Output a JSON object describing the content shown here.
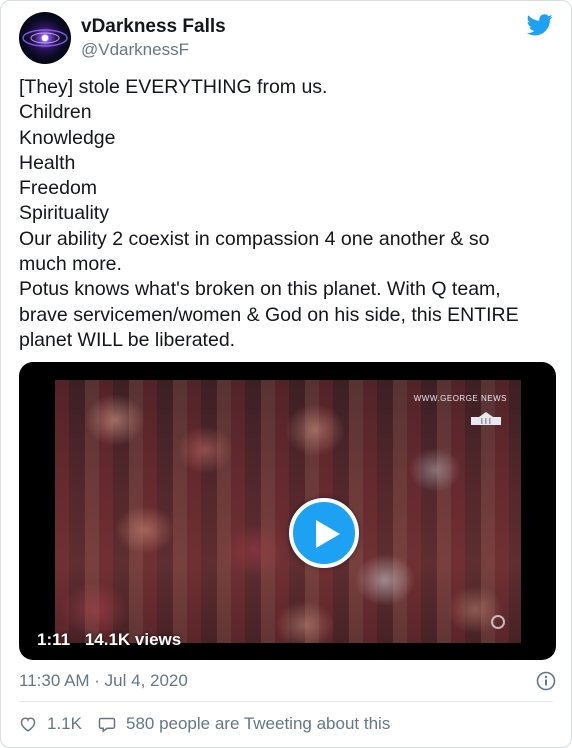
{
  "tweet": {
    "display_name": "vDarkness Falls",
    "handle": "@VdarknessF",
    "lines": [
      "[They] stole EVERYTHING from us.",
      "Children",
      "Knowledge",
      "Health",
      "Freedom",
      "Spirituality",
      "Our ability 2 coexist in compassion 4 one another & so",
      "much more.",
      "Potus knows what's broken on this planet. With Q team,",
      "brave servicemen/women & God on his side, this ENTIRE",
      "planet WILL be liberated."
    ],
    "timestamp": "11:30 AM · Jul 4, 2020"
  },
  "video": {
    "duration": "1:11",
    "views": "14.1K views",
    "watermark": "WWW.GEORGE NEWS"
  },
  "footer": {
    "likes": "1.1K",
    "conversation": "580 people are Tweeting about this"
  },
  "colors": {
    "accent": "#1da1f2",
    "secondary_text": "#657786",
    "primary_text": "#14171a"
  },
  "icons": [
    "twitter-bird-icon",
    "play-icon",
    "info-icon",
    "heart-icon",
    "speech-bubble-icon"
  ]
}
